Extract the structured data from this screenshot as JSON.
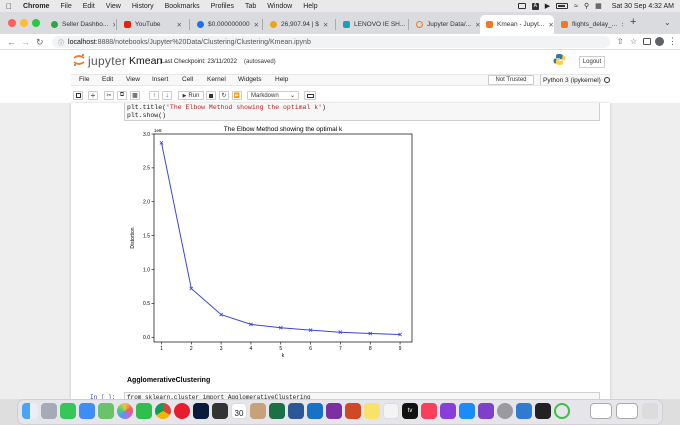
{
  "menubar": {
    "apple": "",
    "app": "Chrome",
    "items": [
      "File",
      "Edit",
      "View",
      "History",
      "Bookmarks",
      "Profiles",
      "Tab",
      "Window",
      "Help"
    ],
    "clock": "Sat 30 Sep  4:32 AM"
  },
  "tabs": [
    {
      "title": "Seller Dashbo...",
      "color": "#2da44e"
    },
    {
      "title": "YouTube",
      "color": "#e62117"
    },
    {
      "title": "$0.000000000",
      "color": "#1a73e8"
    },
    {
      "title": "26,907.94 | $",
      "color": "#f0a30a"
    },
    {
      "title": "LENOVO IE SH...",
      "color": "#16a3b8"
    },
    {
      "title": "Jupyter Data/...",
      "color": "#f37726"
    },
    {
      "title": "Kmean - Jupyt...",
      "color": "#f37726"
    },
    {
      "title": "flights_delay_...",
      "color": "#f37726"
    }
  ],
  "address": {
    "host": "localhost",
    "path": ":8888/notebooks/Jupyter%20Data/Clustering/Clustering/Kmean.ipynb"
  },
  "jupyter": {
    "brand": "jupyter",
    "notebook_name": "Kmean",
    "checkpoint": "Last Checkpoint: 23/11/2022",
    "autosaved": "(autosaved)",
    "logout": "Logout",
    "menu": [
      "File",
      "Edit",
      "View",
      "Insert",
      "Cell",
      "Kernel",
      "Widgets",
      "Help"
    ],
    "trust": "Not Trusted",
    "kernel": "Python 3 (ipykernel)",
    "run_label": "Run",
    "cell_type": "Markdown"
  },
  "cells": {
    "code_line1_prefix": "plt.title(",
    "code_line1_string": "'The Elbow Method showing the optimal k'",
    "code_line1_suffix": ")",
    "code_line2": "plt.show()",
    "markdown_heading": "AgglomerativeClustering",
    "next_prompt": "In [ ]:",
    "next_code": "from sklearn.cluster import AgglomerativeClustering"
  },
  "chart_data": {
    "type": "line",
    "title": "The Elbow Method showing the optimal k",
    "xlabel": "k",
    "ylabel": "Distortion",
    "offset_label": "1e8",
    "x": [
      1,
      2,
      3,
      4,
      5,
      6,
      7,
      8,
      9
    ],
    "y": [
      2.87,
      0.72,
      0.335,
      0.19,
      0.14,
      0.105,
      0.075,
      0.055,
      0.04
    ],
    "xlim": [
      0.75,
      9.4
    ],
    "ylim": [
      -0.07,
      3.0
    ],
    "xticks": [
      "1",
      "2",
      "3",
      "4",
      "5",
      "6",
      "7",
      "8",
      "9"
    ],
    "yticks": [
      "0.0",
      "0.5",
      "1.0",
      "1.5",
      "2.0",
      "2.5",
      "3.0"
    ],
    "ytick_values": [
      0,
      0.5,
      1.0,
      1.5,
      2.0,
      2.5,
      3.0
    ],
    "color": "#3b46d8",
    "marker": "x",
    "grid": false
  },
  "dock": {
    "tv_label": "tv",
    "calendar_day": "30"
  }
}
